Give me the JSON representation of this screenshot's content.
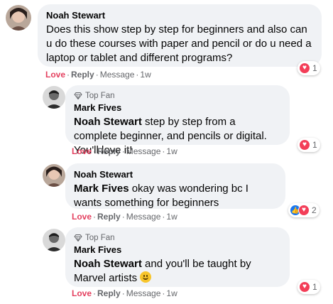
{
  "colors": {
    "bubble_bg": "#f0f2f5",
    "love_red": "#e4405f",
    "meta_gray": "#65676b",
    "heart_red": "#f33e58",
    "like_blue": "#1877f2"
  },
  "comments": [
    {
      "author": "Noah Stewart",
      "mention": "",
      "text": "Does this show step by step for beginners and also can u do these courses with paper and pencil or do u need a laptop or tablet and different programs?",
      "actions": {
        "love": "Love",
        "reply": "Reply",
        "message": "Message",
        "time": "1w"
      },
      "reaction_icons": [
        "heart-icon"
      ],
      "reaction_count": "1"
    },
    {
      "badge": "Top Fan",
      "author": "Mark Fives",
      "mention": "Noah Stewart",
      "text": "step by step from a complete beginner, and pencils or digital. You'll love it!",
      "actions": {
        "love": "Love",
        "reply": "Reply",
        "message": "Message",
        "time": "1w"
      },
      "reaction_icons": [
        "heart-icon"
      ],
      "reaction_count": "1"
    },
    {
      "author": "Noah Stewart",
      "mention": "Mark Fives",
      "text": "okay was wondering bc I wants something for beginners",
      "actions": {
        "love": "Love",
        "reply": "Reply",
        "message": "Message",
        "time": "1w"
      },
      "reaction_icons": [
        "like-icon",
        "heart-icon"
      ],
      "reaction_count": "2"
    },
    {
      "badge": "Top Fan",
      "author": "Mark Fives",
      "mention": "Noah Stewart",
      "text": "and you'll be taught by Marvel artists",
      "emoji": "smile-emoji-icon",
      "actions": {
        "love": "Love",
        "reply": "Reply",
        "message": "Message",
        "time": "1w"
      },
      "reaction_icons": [
        "heart-icon"
      ],
      "reaction_count": "1"
    }
  ]
}
